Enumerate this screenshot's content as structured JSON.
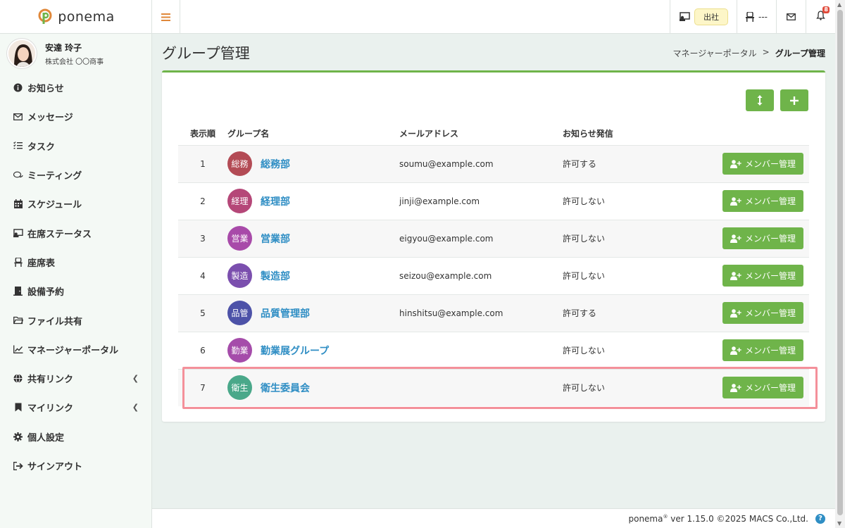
{
  "app": {
    "brand_name": "ponema",
    "accent_color": "#6fb44a",
    "link_color": "#2f8ec4"
  },
  "topbar": {
    "menu_icon": "hamburger-icon",
    "attendance_label": "出社",
    "seat_label": "---",
    "notification_count": "8"
  },
  "user": {
    "name": "安達 玲子",
    "company": "株式会社 〇〇商事"
  },
  "sidebar": {
    "items": [
      {
        "label": "お知らせ",
        "icon": "info-icon"
      },
      {
        "label": "メッセージ",
        "icon": "envelope-icon"
      },
      {
        "label": "タスク",
        "icon": "tasks-icon"
      },
      {
        "label": "ミーティング",
        "icon": "chat-icon"
      },
      {
        "label": "スケジュール",
        "icon": "calendar-icon"
      },
      {
        "label": "在席ステータス",
        "icon": "presence-icon"
      },
      {
        "label": "座席表",
        "icon": "chair-icon"
      },
      {
        "label": "設備予約",
        "icon": "door-icon"
      },
      {
        "label": "ファイル共有",
        "icon": "folder-icon"
      },
      {
        "label": "マネージャーポータル",
        "icon": "chart-icon"
      },
      {
        "label": "共有リンク",
        "icon": "globe-icon"
      },
      {
        "label": "マイリンク",
        "icon": "bookmark-icon"
      },
      {
        "label": "個人設定",
        "icon": "gear-icon"
      },
      {
        "label": "サインアウト",
        "icon": "sign-out-icon"
      }
    ]
  },
  "page": {
    "title": "グループ管理",
    "breadcrumb_parent": "マネージャーポータル",
    "breadcrumb_sep": ">",
    "breadcrumb_current": "グループ管理"
  },
  "table": {
    "headers": {
      "order": "表示順",
      "name": "グループ名",
      "email": "メールアドレス",
      "notice": "お知らせ発信"
    },
    "action_label": "メンバー管理",
    "rows": [
      {
        "order": "1",
        "badge": "総務",
        "badge_color": "#b34b55",
        "name": "総務部",
        "email": "soumu@example.com",
        "notice": "許可する"
      },
      {
        "order": "2",
        "badge": "経理",
        "badge_color": "#b54778",
        "name": "経理部",
        "email": "jinji@example.com",
        "notice": "許可しない"
      },
      {
        "order": "3",
        "badge": "営業",
        "badge_color": "#a84aa9",
        "name": "営業部",
        "email": "eigyou@example.com",
        "notice": "許可しない"
      },
      {
        "order": "4",
        "badge": "製造",
        "badge_color": "#7b4fae",
        "name": "製造部",
        "email": "seizou@example.com",
        "notice": "許可しない"
      },
      {
        "order": "5",
        "badge": "品管",
        "badge_color": "#4d52a8",
        "name": "品質管理部",
        "email": "hinshitsu@example.com",
        "notice": "許可する"
      },
      {
        "order": "6",
        "badge": "勤業",
        "badge_color": "#a54caa",
        "name": "勤業展グループ",
        "email": "",
        "notice": "許可しない"
      },
      {
        "order": "7",
        "badge": "衛生",
        "badge_color": "#4aa88a",
        "name": "衛生委員会",
        "email": "",
        "notice": "許可しない"
      }
    ]
  },
  "footer": {
    "brand": "ponema",
    "reg_mark": "®",
    "version_text": " ver 1.15.0 ©2025 MACS Co.,Ltd.",
    "help_label": "?"
  }
}
